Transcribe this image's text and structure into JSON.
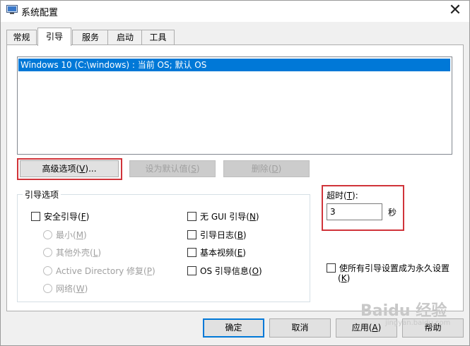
{
  "window": {
    "title": "系统配置",
    "close_glyph": "✕"
  },
  "tabs": [
    {
      "label": "常规"
    },
    {
      "label": "引导"
    },
    {
      "label": "服务"
    },
    {
      "label": "启动"
    },
    {
      "label": "工具"
    }
  ],
  "active_tab": "引导",
  "os_list": {
    "items": [
      "Windows 10 (C:\\windows) : 当前 OS; 默认 OS"
    ]
  },
  "buttons": {
    "advanced": {
      "text": "高级选项(",
      "key": "V",
      "tail": ")..."
    },
    "set_default": {
      "text": "设为默认值(",
      "key": "S",
      "tail": ")"
    },
    "delete": {
      "text": "删除(",
      "key": "D",
      "tail": ")"
    }
  },
  "boot_options": {
    "legend": "引导选项",
    "safe_boot": {
      "text": "安全引导(",
      "key": "F",
      "tail": ")"
    },
    "radios": [
      {
        "text": "最小(",
        "key": "M",
        "tail": ")"
      },
      {
        "text": "其他外壳(",
        "key": "L",
        "tail": ")"
      },
      {
        "text": "Active Directory 修复(",
        "key": "P",
        "tail": ")"
      },
      {
        "text": "网络(",
        "key": "W",
        "tail": ")"
      }
    ],
    "checks": [
      {
        "text": "无 GUI 引导(",
        "key": "N",
        "tail": ")"
      },
      {
        "text": "引导日志(",
        "key": "B",
        "tail": ")"
      },
      {
        "text": "基本视频(",
        "key": "E",
        "tail": ")"
      },
      {
        "text": "OS 引导信息(",
        "key": "O",
        "tail": ")"
      }
    ]
  },
  "timeout": {
    "label": "超时(",
    "key": "T",
    "tail": "):",
    "value": "3",
    "unit": "秒"
  },
  "permanent": {
    "line1": "使所有引导设置成为永久设置",
    "key": "K",
    "open": "(",
    "close": ")"
  },
  "footer": {
    "ok": "确定",
    "cancel": "取消",
    "apply": {
      "text": "应用(",
      "key": "A",
      "tail": ")"
    },
    "help": "帮助"
  },
  "watermark": {
    "text": "Baidu 经验",
    "sub": "jingyan.baidu.com"
  }
}
